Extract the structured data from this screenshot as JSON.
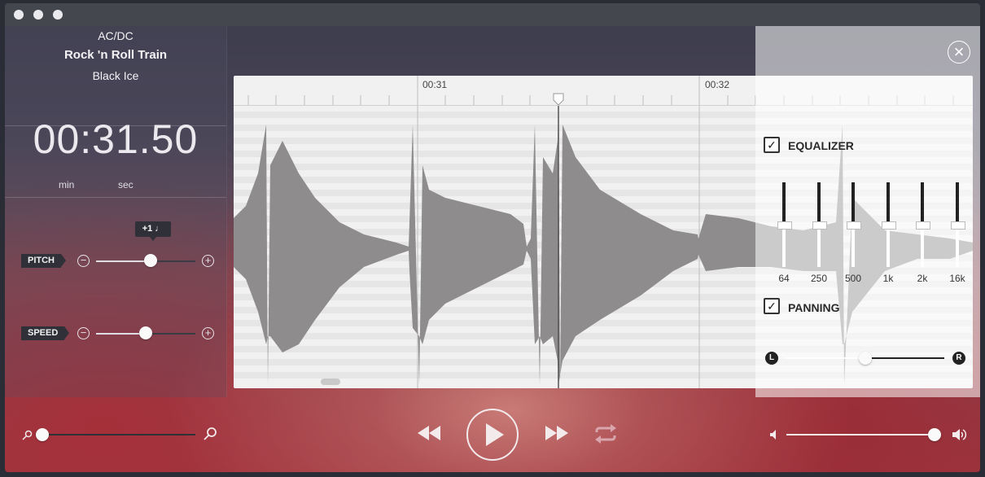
{
  "window": {
    "controls": [
      "close",
      "minimize",
      "zoom"
    ]
  },
  "track": {
    "artist": "AC/DC",
    "title": "Rock 'n Roll Train",
    "album": "Black Ice"
  },
  "time": {
    "display": "00:31.50",
    "min_label": "min",
    "sec_label": "sec"
  },
  "pitch": {
    "label": "PITCH",
    "tooltip": "+1 ♩",
    "value_fraction": 0.55
  },
  "speed": {
    "label": "SPEED",
    "value_fraction": 0.5
  },
  "waveform": {
    "ruler_labels": [
      "00:31",
      "00:32"
    ]
  },
  "equalizer": {
    "label": "EQUALIZER",
    "checked": true,
    "bands": [
      "64",
      "250",
      "500",
      "1k",
      "2k",
      "16k"
    ],
    "band_levels_fraction": [
      0.5,
      0.5,
      0.5,
      0.5,
      0.5,
      0.5
    ]
  },
  "panning": {
    "label": "PANNING",
    "checked": true,
    "left_label": "L",
    "right_label": "R",
    "value_fraction": 0.5
  },
  "zoom": {
    "value_fraction": 0.0
  },
  "volume": {
    "value_fraction": 0.96
  },
  "colors": {
    "accent_light": "#f3eaec",
    "panel_dark": "#2f3038"
  }
}
